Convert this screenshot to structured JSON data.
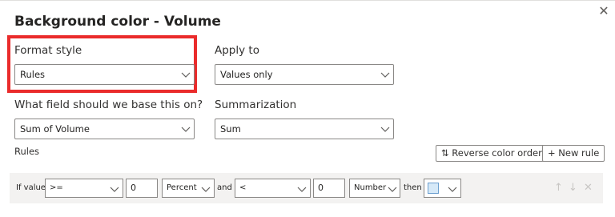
{
  "dialog": {
    "title": "Background color - Volume",
    "close_icon": "close-icon"
  },
  "format_style": {
    "label": "Format style",
    "value": "Rules"
  },
  "apply_to": {
    "label": "Apply to",
    "value": "Values only"
  },
  "base_field": {
    "label": "What field should we base this on?",
    "value": "Sum of Volume"
  },
  "summarization": {
    "label": "Summarization",
    "value": "Sum"
  },
  "rules_section": {
    "label": "Rules",
    "reverse_button": "Reverse color order",
    "reverse_icon": "⇅",
    "new_rule_button": "New rule",
    "new_rule_icon": "+"
  },
  "rule": {
    "if_value_label": "If value",
    "operator1": ">=",
    "value1": "0",
    "type1": "Percent",
    "and_label": "and",
    "operator2": "<",
    "value2": "0",
    "type2": "Number",
    "then_label": "then",
    "color": "#d6e9f8",
    "move_up_icon": "↑",
    "move_down_icon": "↓",
    "delete_icon": "✕"
  },
  "colors": {
    "highlight_border": "#ea2b2b",
    "rule_row_bg": "#f3f2f1"
  }
}
